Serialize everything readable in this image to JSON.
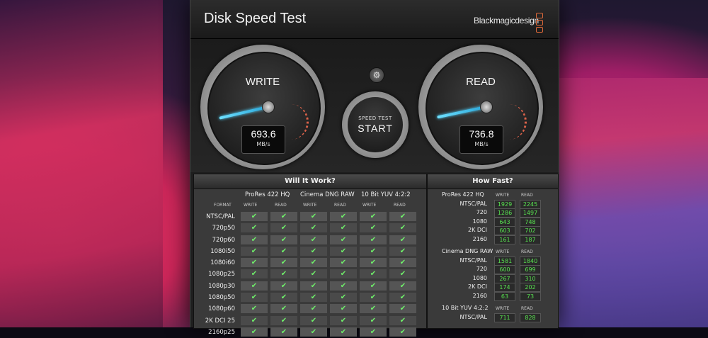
{
  "app": {
    "title": "Disk Speed Test",
    "brand": "Blackmagicdesign"
  },
  "gauges": {
    "write": {
      "label": "WRITE",
      "value": "693.6",
      "unit": "MB/s"
    },
    "read": {
      "label": "READ",
      "value": "736.8",
      "unit": "MB/s"
    }
  },
  "controls": {
    "settings_icon": "gear-icon",
    "start_small": "SPEED TEST",
    "start_big": "START"
  },
  "will_it_work": {
    "title": "Will It Work?",
    "format_header": "FORMAT",
    "codecs": [
      "ProRes 422 HQ",
      "Cinema DNG RAW",
      "10 Bit YUV 4:2:2"
    ],
    "col_write": "WRITE",
    "col_read": "READ",
    "check": "✔",
    "formats": [
      "NTSC/PAL",
      "720p50",
      "720p60",
      "1080i50",
      "1080i60",
      "1080p25",
      "1080p30",
      "1080p50",
      "1080p60",
      "2K DCI 25",
      "2160p25"
    ]
  },
  "how_fast": {
    "title": "How Fast?",
    "col_write": "WRITE",
    "col_read": "READ",
    "groups": [
      {
        "name": "ProRes 422 HQ",
        "rows": [
          {
            "format": "NTSC/PAL",
            "write": "1929",
            "read": "2245"
          },
          {
            "format": "720",
            "write": "1286",
            "read": "1497"
          },
          {
            "format": "1080",
            "write": "643",
            "read": "748"
          },
          {
            "format": "2K DCI",
            "write": "603",
            "read": "702"
          },
          {
            "format": "2160",
            "write": "161",
            "read": "187"
          }
        ]
      },
      {
        "name": "Cinema DNG RAW",
        "rows": [
          {
            "format": "NTSC/PAL",
            "write": "1581",
            "read": "1840"
          },
          {
            "format": "720",
            "write": "600",
            "read": "699"
          },
          {
            "format": "1080",
            "write": "267",
            "read": "310"
          },
          {
            "format": "2K DCI",
            "write": "174",
            "read": "202"
          },
          {
            "format": "2160",
            "write": "63",
            "read": "73"
          }
        ]
      },
      {
        "name": "10 Bit YUV 4:2:2",
        "rows": [
          {
            "format": "NTSC/PAL",
            "write": "711",
            "read": "828"
          }
        ]
      }
    ]
  }
}
